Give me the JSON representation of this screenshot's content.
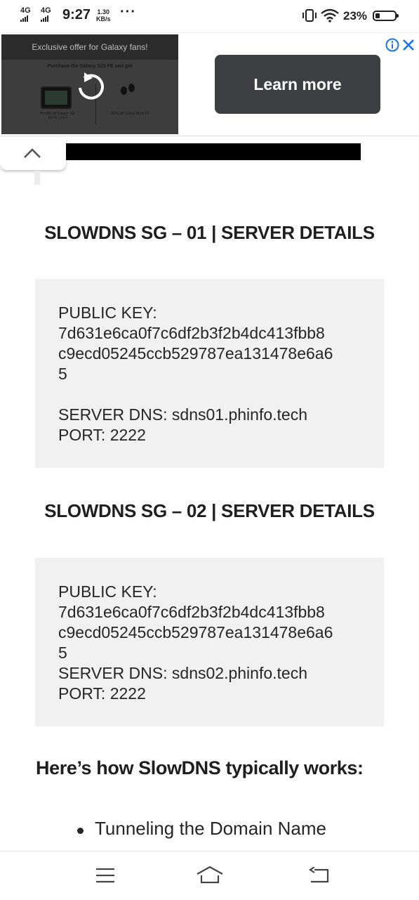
{
  "status_bar": {
    "network1": "4G",
    "network2": "4G",
    "time": "9:27",
    "speed_value": "1.30",
    "speed_unit": "KB/s",
    "more": "···",
    "battery_pct": "23%",
    "battery_level": 0.23
  },
  "ad": {
    "banner_text": "Exclusive offer for Galaxy fans!",
    "promo_text": "Purchase the Galaxy S23 FE and get",
    "offer1": "₱5,000 off Galaxy Tab S9 FE | FE+",
    "offer2": "30% off Galaxy Buds FE",
    "cta_label": "Learn more",
    "info_icon": "info-icon",
    "close_icon": "close-icon"
  },
  "content": {
    "server1": {
      "heading": "SLOWDNS SG – 01 | SERVER DETAILS",
      "key_label": "PUBLIC KEY:",
      "key_line1": "7d631e6ca0f7c6df2b3f2b4dc413fbb8",
      "key_line2": "c9ecd05245ccb529787ea131478e6a6",
      "key_line3": "5",
      "dns": "SERVER DNS: sdns01.phinfo.tech",
      "port": "PORT: 2222"
    },
    "server2": {
      "heading": "SLOWDNS SG – 02 | SERVER DETAILS",
      "key_label": "PUBLIC KEY:",
      "key_line1": "7d631e6ca0f7c6df2b3f2b4dc413fbb8",
      "key_line2": "c9ecd05245ccb529787ea131478e6a6",
      "key_line3": "5",
      "dns": "SERVER DNS: sdns02.phinfo.tech",
      "port": "PORT: 2222"
    },
    "how_heading": "Here’s how SlowDNS typically works:",
    "bullets": [
      "Tunneling the Domain Name"
    ]
  },
  "nav": {
    "menu_icon": "menu-icon",
    "home_icon": "home-icon",
    "back_icon": "back-icon"
  }
}
